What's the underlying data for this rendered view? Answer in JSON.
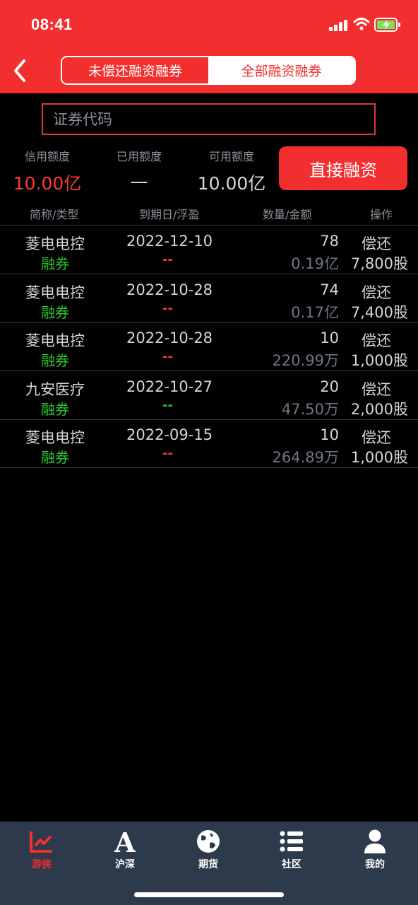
{
  "status_bar": {
    "time": "08:41"
  },
  "header": {
    "segments": [
      "未偿还融资融券",
      "全部融资融券"
    ],
    "active_segment": 1
  },
  "search": {
    "placeholder": "证券代码"
  },
  "quota": {
    "credit": {
      "label": "信用额度",
      "value": "10.00亿"
    },
    "used": {
      "label": "已用额度",
      "value": "一"
    },
    "available": {
      "label": "可用额度",
      "value": "10.00亿"
    },
    "direct_button": "直接融资"
  },
  "table": {
    "headers": [
      "简称/类型",
      "到期日/浮盈",
      "数量/金额",
      "操作"
    ],
    "rows": [
      {
        "name": "菱电电控",
        "type": "融券",
        "date": "2022-12-10",
        "pnl": "--",
        "pnl_color": "red",
        "qty": "78",
        "amount": "0.19亿",
        "action": "偿还",
        "shares": "7,800股"
      },
      {
        "name": "菱电电控",
        "type": "融券",
        "date": "2022-10-28",
        "pnl": "--",
        "pnl_color": "red",
        "qty": "74",
        "amount": "0.17亿",
        "action": "偿还",
        "shares": "7,400股"
      },
      {
        "name": "菱电电控",
        "type": "融券",
        "date": "2022-10-28",
        "pnl": "--",
        "pnl_color": "red",
        "qty": "10",
        "amount": "220.99万",
        "action": "偿还",
        "shares": "1,000股"
      },
      {
        "name": "九安医疗",
        "type": "融券",
        "date": "2022-10-27",
        "pnl": "--",
        "pnl_color": "green",
        "qty": "20",
        "amount": "47.50万",
        "action": "偿还",
        "shares": "2,000股"
      },
      {
        "name": "菱电电控",
        "type": "融券",
        "date": "2022-09-15",
        "pnl": "--",
        "pnl_color": "red",
        "qty": "10",
        "amount": "264.89万",
        "action": "偿还",
        "shares": "1,000股"
      }
    ]
  },
  "tabbar": {
    "items": [
      {
        "label": "游侠",
        "icon": "chart-line-icon",
        "active": true
      },
      {
        "label": "沪深",
        "icon": "letter-a-icon",
        "active": false
      },
      {
        "label": "期货",
        "icon": "globe-icon",
        "active": false
      },
      {
        "label": "社区",
        "icon": "list-icon",
        "active": false
      },
      {
        "label": "我的",
        "icon": "user-icon",
        "active": false
      }
    ]
  },
  "colors": {
    "accent": "#f32e2e",
    "green": "#2ec52e",
    "tabbar_bg": "#2c3a4b"
  }
}
